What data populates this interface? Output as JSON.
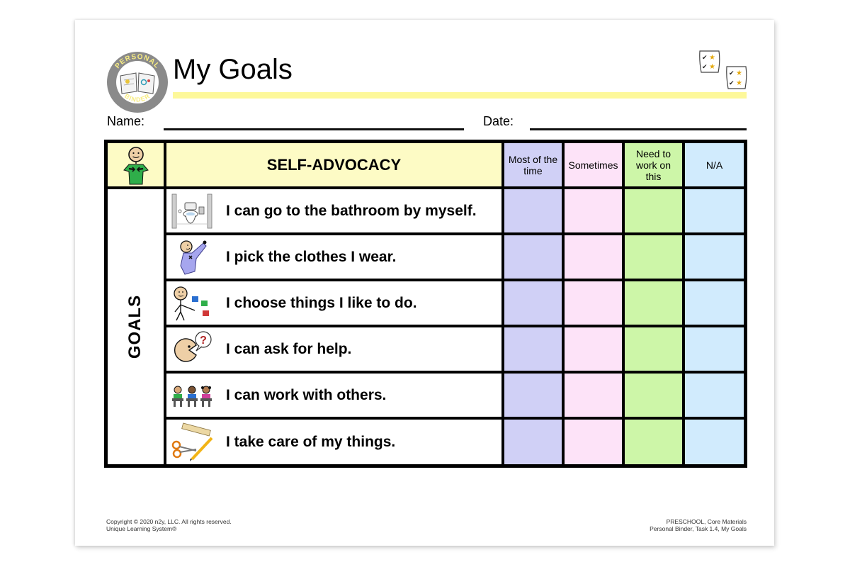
{
  "header": {
    "logo": {
      "icon": "personal-binder-logo",
      "top_text": "PERSONAL",
      "bottom_text": "BINDER"
    },
    "title": "My Goals",
    "corner_icon": "checklist-stars-icon"
  },
  "form": {
    "name_label": "Name:",
    "name_value": "",
    "date_label": "Date:",
    "date_value": ""
  },
  "table": {
    "category_icon": "self-advocacy-person-icon",
    "category_title": "SELF-ADVOCACY",
    "section_label": "GOALS",
    "columns": [
      {
        "label": "Most of the time",
        "color": "#d0d0f6"
      },
      {
        "label": "Sometimes",
        "color": "#fde3f8"
      },
      {
        "label": "Need to work on this",
        "color": "#cdf6a8"
      },
      {
        "label": "N/A",
        "color": "#d1ebfd"
      }
    ],
    "goals": [
      {
        "icon": "bathroom-toilet-icon",
        "text": "I can go to the bathroom by myself.",
        "rating": null
      },
      {
        "icon": "pick-clothes-icon",
        "text": "I pick the clothes I wear.",
        "rating": null
      },
      {
        "icon": "choose-things-icon",
        "text": "I choose things I like to do.",
        "rating": null
      },
      {
        "icon": "ask-for-help-icon",
        "text": "I can ask for help.",
        "rating": null
      },
      {
        "icon": "work-with-others-icon",
        "text": "I can work with others.",
        "rating": null
      },
      {
        "icon": "school-supplies-icon",
        "text": "I take care of my things.",
        "rating": null
      }
    ]
  },
  "footer": {
    "left_line1": "Copyright © 2020 n2y, LLC. All rights reserved.",
    "left_line2": "Unique Learning System®",
    "right_line1": "PRESCHOOL, Core Materials",
    "right_line2": "Personal Binder, Task 1.4, My Goals"
  }
}
